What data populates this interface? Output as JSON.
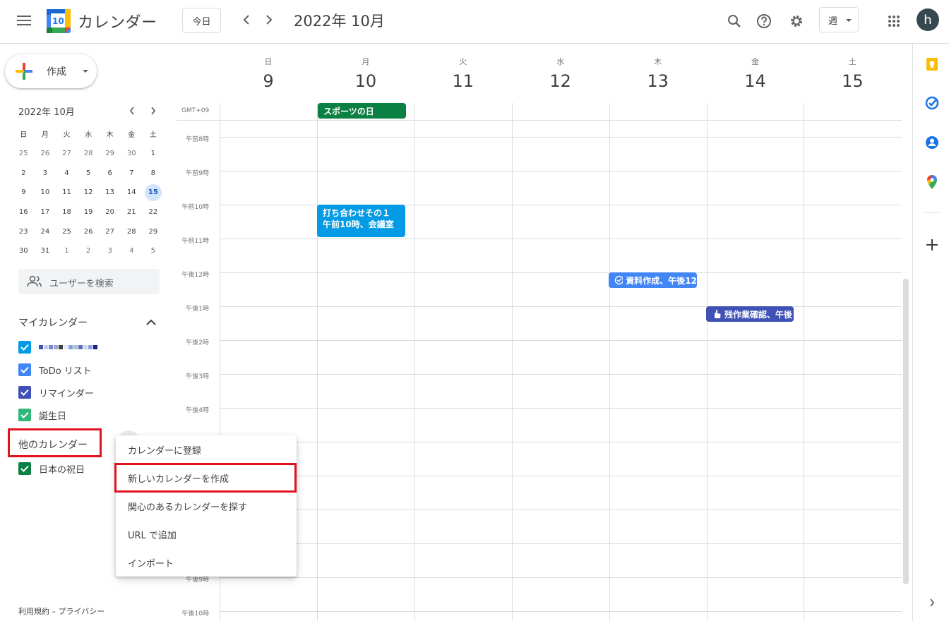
{
  "header": {
    "app_title": "カレンダー",
    "logo_day": "10",
    "today_label": "今日",
    "month_label": "2022年 10月",
    "view_label": "週",
    "avatar_letter": "h"
  },
  "sidebar": {
    "create_label": "作成",
    "mini_calendar": {
      "title": "2022年 10月",
      "weekdays": [
        "日",
        "月",
        "火",
        "水",
        "木",
        "金",
        "土"
      ],
      "days": [
        "25",
        "26",
        "27",
        "28",
        "29",
        "30",
        "1",
        "2",
        "3",
        "4",
        "5",
        "6",
        "7",
        "8",
        "9",
        "10",
        "11",
        "12",
        "13",
        "14",
        "15",
        "16",
        "17",
        "18",
        "19",
        "20",
        "21",
        "22",
        "23",
        "24",
        "25",
        "26",
        "27",
        "28",
        "29",
        "30",
        "31",
        "1",
        "2",
        "3",
        "4",
        "5"
      ],
      "selected": "15"
    },
    "search_people_placeholder": "ユーザーを検索",
    "my_calendars_title": "マイカレンダー",
    "my_calendars": [
      {
        "name": "",
        "color": "#039be5"
      },
      {
        "name": "ToDo リスト",
        "color": "#4285f4"
      },
      {
        "name": "リマインダー",
        "color": "#3f51b5"
      },
      {
        "name": "誕生日",
        "color": "#33b679"
      }
    ],
    "other_calendars_title": "他のカレンダー",
    "other_calendars": [
      {
        "name": "日本の祝日",
        "color": "#0b8043"
      }
    ],
    "footer": "利用規約 – プライバシー"
  },
  "week": {
    "days": [
      {
        "dow": "日",
        "num": "9"
      },
      {
        "dow": "月",
        "num": "10"
      },
      {
        "dow": "火",
        "num": "11"
      },
      {
        "dow": "水",
        "num": "12"
      },
      {
        "dow": "木",
        "num": "13"
      },
      {
        "dow": "金",
        "num": "14"
      },
      {
        "dow": "土",
        "num": "15"
      }
    ],
    "timezone": "GMT+09",
    "hours": [
      "午前8時",
      "午前9時",
      "午前10時",
      "午前11時",
      "午後12時",
      "午後1時",
      "午後2時",
      "午後3時",
      "午後4時",
      "午後9時",
      "午後10時"
    ]
  },
  "events": {
    "holiday": {
      "title": "スポーツの日",
      "color": "#0b8043"
    },
    "meeting": {
      "title": "打ち合わせその１",
      "detail": "午前10時、会議室",
      "color": "#039be5"
    },
    "task": {
      "title": "資料作成、午後12",
      "color": "#4285f4"
    },
    "reminder": {
      "title": "残作業確認、午後",
      "color": "#3f51b5"
    }
  },
  "menu": {
    "items": [
      "カレンダーに登録",
      "新しいカレンダーを作成",
      "関心のあるカレンダーを探す",
      "URL で追加",
      "インポート"
    ]
  },
  "colors": {
    "accent": "#1a73e8",
    "highlight_red": "#e0121e"
  }
}
